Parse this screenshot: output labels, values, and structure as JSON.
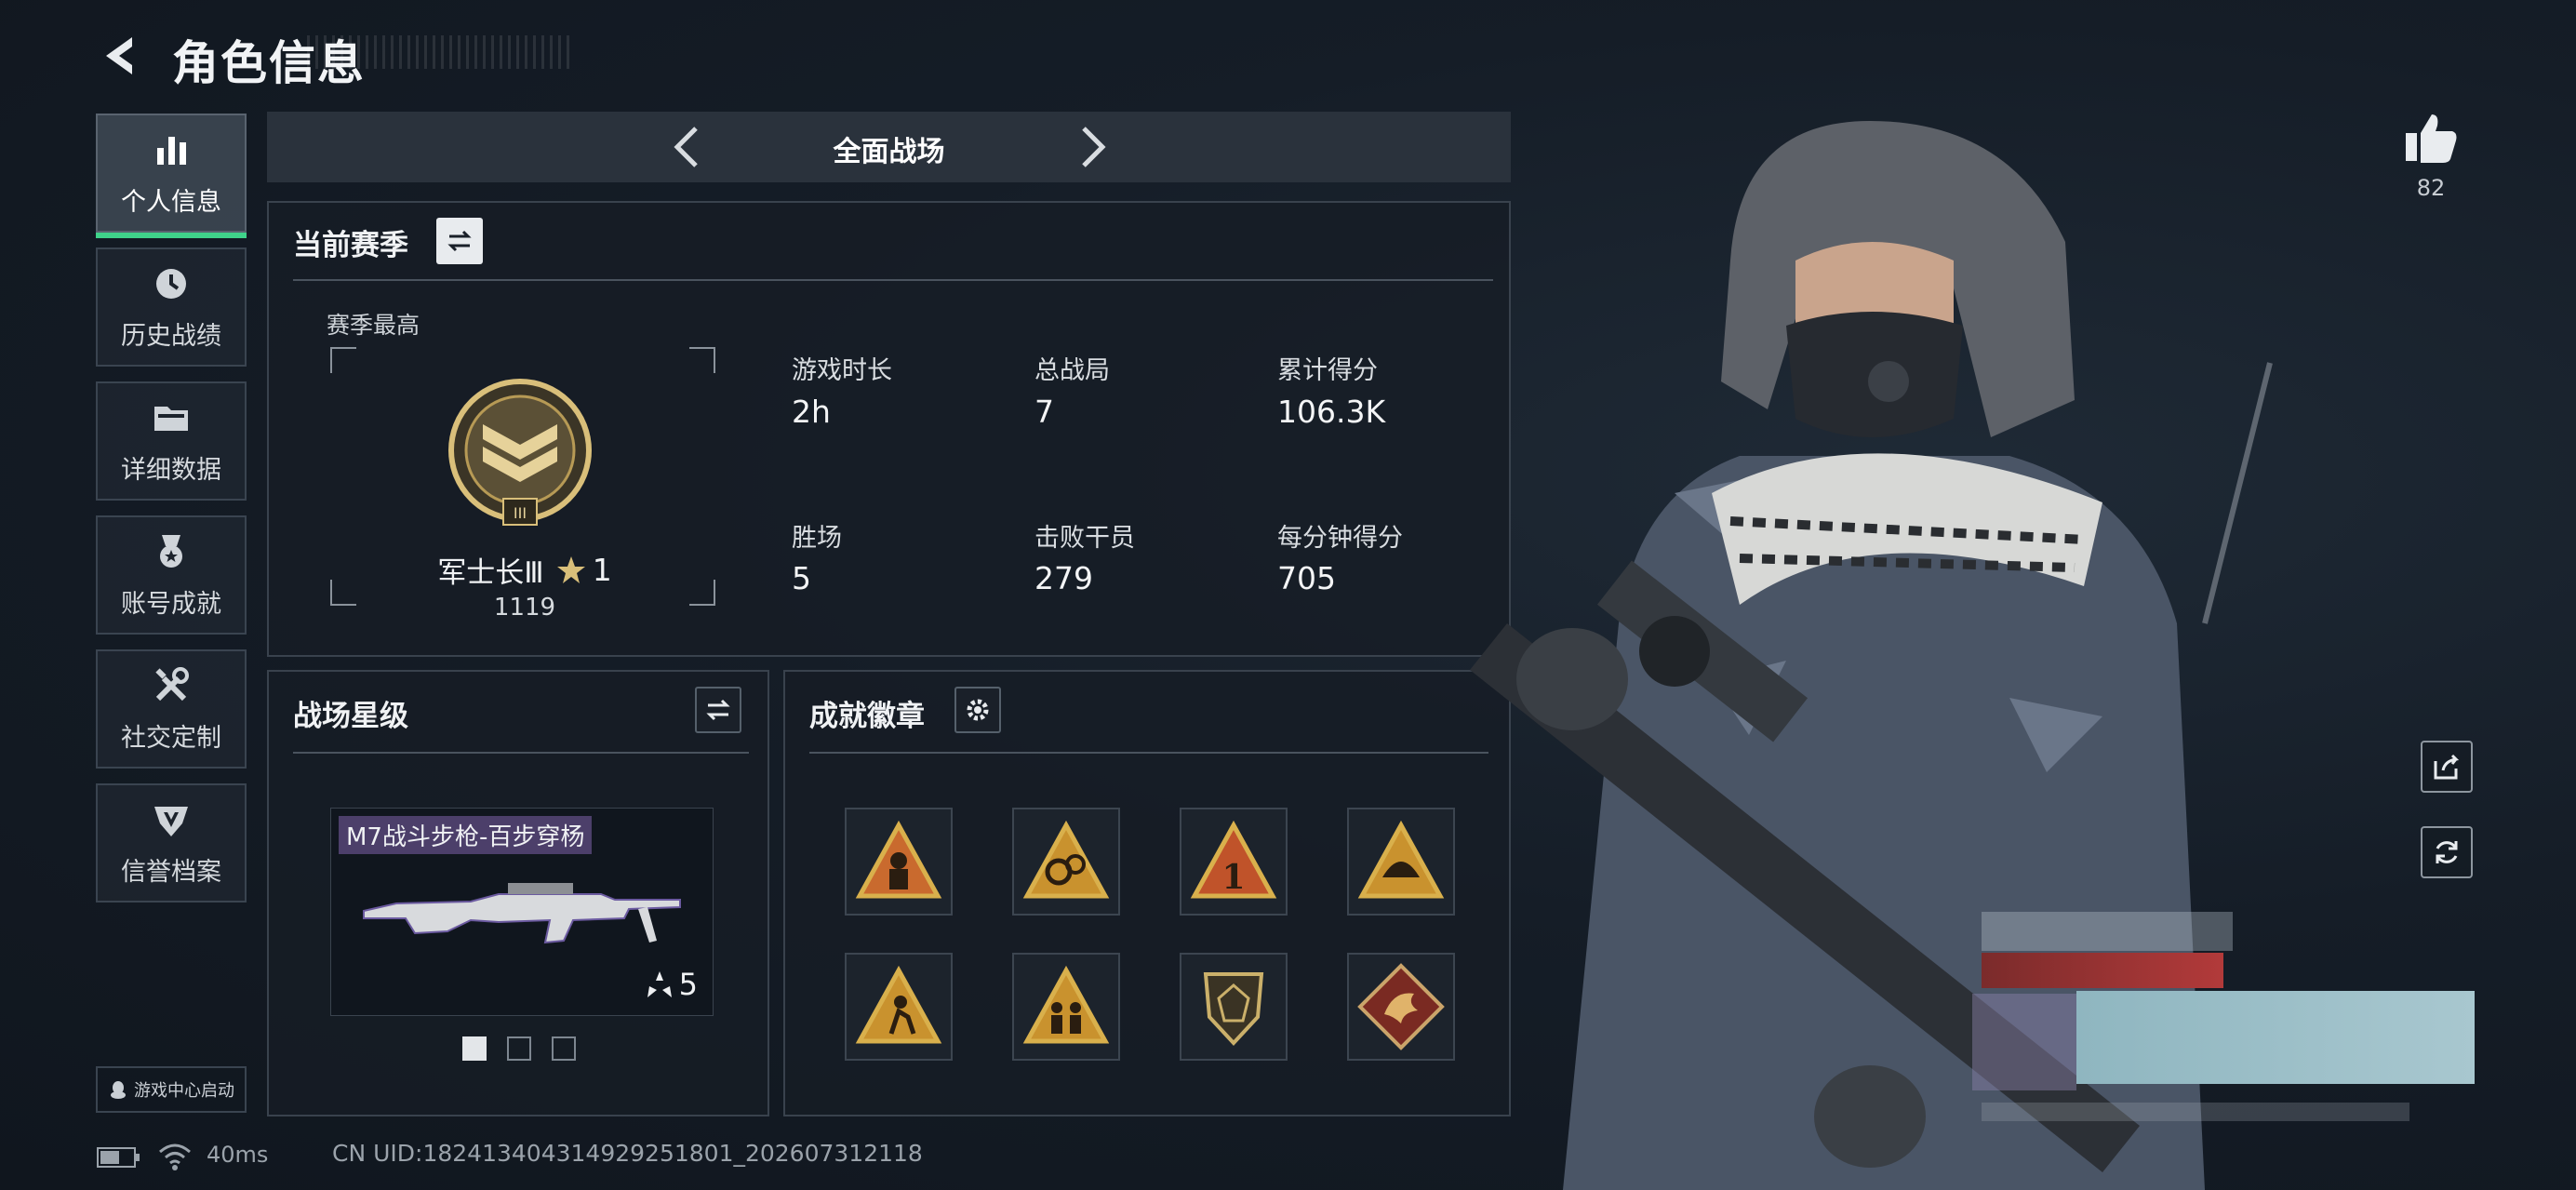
{
  "header": {
    "title": "角色信息"
  },
  "sidebar": {
    "items": [
      {
        "label": "个人信息",
        "icon": "bar-chart-icon",
        "active": true
      },
      {
        "label": "历史战绩",
        "icon": "history-icon"
      },
      {
        "label": "详细数据",
        "icon": "folder-icon"
      },
      {
        "label": "账号成就",
        "icon": "medal-icon"
      },
      {
        "label": "社交定制",
        "icon": "tools-icon"
      },
      {
        "label": "信誉档案",
        "icon": "shield-icon"
      }
    ],
    "game_center": "游戏中心启动"
  },
  "mode": {
    "label": "全面战场"
  },
  "season": {
    "title": "当前赛季",
    "best_label": "赛季最高",
    "rank_name": "军士长Ⅲ",
    "rank_stars": "1",
    "rank_score": "1119",
    "rank_roman": "III",
    "stats": [
      {
        "label": "游戏时长",
        "value": "2h"
      },
      {
        "label": "总战局",
        "value": "7"
      },
      {
        "label": "累计得分",
        "value": "106.3K"
      },
      {
        "label": "胜场",
        "value": "5"
      },
      {
        "label": "击败干员",
        "value": "279"
      },
      {
        "label": "每分钟得分",
        "value": "705"
      }
    ]
  },
  "star_level": {
    "title": "战场星级",
    "weapon_name": "M7战斗步枪-百步穿杨",
    "weapon_level": "5",
    "pages": 3,
    "active_page": 1
  },
  "achievements": {
    "title": "成就徽章",
    "badges": [
      "soldier-badge-icon",
      "gears-badge-icon",
      "number-one-badge-icon",
      "helmet-badge-icon",
      "runner-badge-icon",
      "squad-badge-icon",
      "crest-badge-icon",
      "dragon-badge-icon"
    ],
    "badge_text_one": "1"
  },
  "right": {
    "likes": "82"
  },
  "status": {
    "ping": "40ms",
    "uid": "CN UID:182413404314929251801_202607312118"
  },
  "colors": {
    "accent": "#3fd38a",
    "gold": "#c9a64a",
    "panel_border": "#39424d"
  }
}
